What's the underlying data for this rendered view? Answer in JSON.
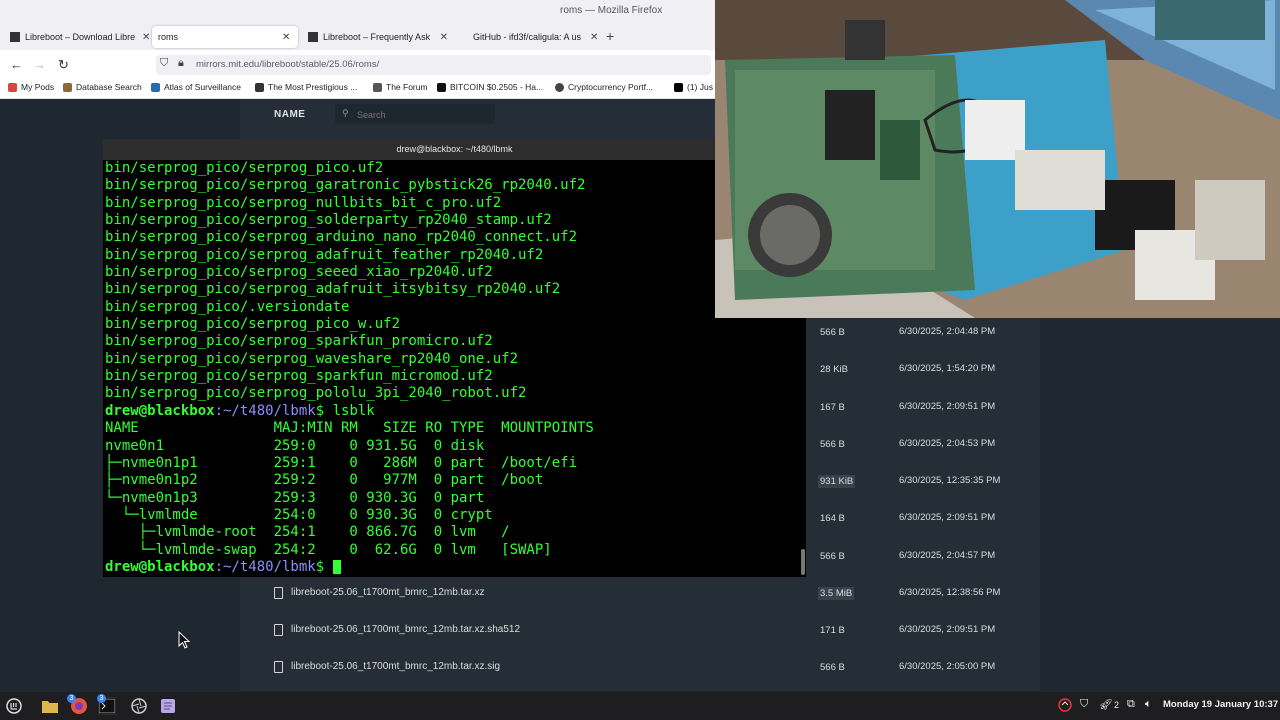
{
  "firefox": {
    "window_title": "roms — Mozilla Firefox",
    "tabs": [
      {
        "label": "Libreboot – Download Libre",
        "active": false
      },
      {
        "label": "roms",
        "active": true
      },
      {
        "label": "Libreboot – Frequently Ask",
        "active": false
      },
      {
        "label": "GitHub - ifd3f/caligula: A us",
        "active": false
      }
    ],
    "url": "mirrors.mit.edu/libreboot/stable/25.06/roms/",
    "bookmarks": [
      "My Pods",
      "Database Search",
      "Atlas of Surveillance",
      "The Most Prestigious ...",
      "The Forum",
      "BITCOIN $0.2505 - Ha...",
      "Cryptocurrency Portf...",
      "(1) Jus"
    ]
  },
  "listing": {
    "name_header": "NAME",
    "search_placeholder": "Search",
    "rows": [
      {
        "name": "",
        "size": "566 B",
        "date": "6/30/2025, 2:04:48 PM",
        "hl": false
      },
      {
        "name": "",
        "size": "28 KiB",
        "date": "6/30/2025, 1:54:20 PM",
        "hl": false
      },
      {
        "name": "",
        "size": "167 B",
        "date": "6/30/2025, 2:09:51 PM",
        "hl": false
      },
      {
        "name": "",
        "size": "566 B",
        "date": "6/30/2025, 2:04:53 PM",
        "hl": false
      },
      {
        "name": "",
        "size": "931 KiB",
        "date": "6/30/2025, 12:35:35 PM",
        "hl": true
      },
      {
        "name": "",
        "size": "164 B",
        "date": "6/30/2025, 2:09:51 PM",
        "hl": false
      },
      {
        "name": "",
        "size": "566 B",
        "date": "6/30/2025, 2:04:57 PM",
        "hl": false
      },
      {
        "name": "libreboot-25.06_t1700mt_bmrc_12mb.tar.xz",
        "size": "3.5 MiB",
        "date": "6/30/2025, 12:38:56 PM",
        "hl": true
      },
      {
        "name": "libreboot-25.06_t1700mt_bmrc_12mb.tar.xz.sha512",
        "size": "171 B",
        "date": "6/30/2025, 2:09:51 PM",
        "hl": false
      },
      {
        "name": "libreboot-25.06_t1700mt_bmrc_12mb.tar.xz.sig",
        "size": "566 B",
        "date": "6/30/2025, 2:05:00 PM",
        "hl": false
      }
    ]
  },
  "terminal": {
    "title": "drew@blackbox: ~/t480/lbmk",
    "prompt_user": "drew@blackbox",
    "prompt_path": ":~/t480/lbmk",
    "lines": [
      "bin/serprog_pico/serprog_pico.uf2",
      "bin/serprog_pico/serprog_garatronic_pybstick26_rp2040.uf2",
      "bin/serprog_pico/serprog_nullbits_bit_c_pro.uf2",
      "bin/serprog_pico/serprog_solderparty_rp2040_stamp.uf2",
      "bin/serprog_pico/serprog_arduino_nano_rp2040_connect.uf2",
      "bin/serprog_pico/serprog_adafruit_feather_rp2040.uf2",
      "bin/serprog_pico/serprog_seeed_xiao_rp2040.uf2",
      "bin/serprog_pico/serprog_adafruit_itsybitsy_rp2040.uf2",
      "bin/serprog_pico/.versiondate",
      "bin/serprog_pico/serprog_pico_w.uf2",
      "bin/serprog_pico/serprog_sparkfun_promicro.uf2",
      "bin/serprog_pico/serprog_waveshare_rp2040_one.uf2",
      "bin/serprog_pico/serprog_sparkfun_micromod.uf2",
      "bin/serprog_pico/serprog_pololu_3pi_2040_robot.uf2"
    ],
    "command": "$ lsblk",
    "lsblk": [
      "NAME                MAJ:MIN RM   SIZE RO TYPE  MOUNTPOINTS",
      "nvme0n1             259:0    0 931.5G  0 disk",
      "├─nvme0n1p1         259:1    0   286M  0 part  /boot/efi",
      "├─nvme0n1p2         259:2    0   977M  0 part  /boot",
      "└─nvme0n1p3         259:3    0 930.3G  0 part",
      "  └─lvmlmde         254:0    0 930.3G  0 crypt",
      "    ├─lvmlmde-root  254:1    0 866.7G  0 lvm   /",
      "    └─lvmlmde-swap  254:2    0  62.6G  0 lvm   [SWAP]"
    ],
    "final_prompt_suffix": "$ "
  },
  "taskbar": {
    "clock": "Monday 19 January 10:37",
    "workspace_count": "2",
    "badge_firefox": "3",
    "badge_terminal": "3"
  }
}
